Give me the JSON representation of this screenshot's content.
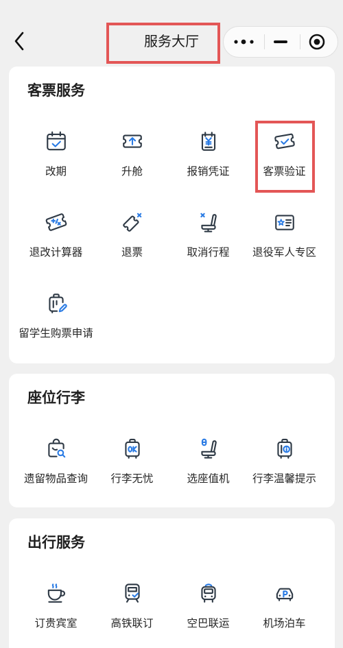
{
  "nav": {
    "back_icon": "chevron-left-icon",
    "title": "服务大厅",
    "title_highlighted": true,
    "capsule": {
      "more_icon": "more-dots-icon",
      "minimize_icon": "minus-icon",
      "close_icon": "target-circle-icon"
    }
  },
  "colors": {
    "page_bg": "#f0f0f0",
    "card_bg": "#ffffff",
    "text": "#222222",
    "icon_stroke": "#2f3a46",
    "icon_accent": "#2a7be4",
    "highlight_box": "#e35656"
  },
  "sections": [
    {
      "title": "客票服务",
      "items": [
        {
          "label": "改期",
          "icon": "calendar-check-icon"
        },
        {
          "label": "升舱",
          "icon": "ticket-upgrade-icon"
        },
        {
          "label": "报销凭证",
          "icon": "receipt-yen-icon"
        },
        {
          "label": "客票验证",
          "icon": "ticket-check-icon",
          "highlighted": true
        },
        {
          "label": "退改计算器",
          "icon": "refund-calculator-icon"
        },
        {
          "label": "退票",
          "icon": "ticket-refund-icon"
        },
        {
          "label": "取消行程",
          "icon": "seat-cancel-icon"
        },
        {
          "label": "退役军人专区",
          "icon": "veteran-card-icon"
        },
        {
          "label": "留学生购票申请",
          "icon": "luggage-pen-icon"
        }
      ]
    },
    {
      "title": "座位行李",
      "items": [
        {
          "label": "遗留物品查询",
          "icon": "bag-search-icon"
        },
        {
          "label": "行李无忧",
          "icon": "suitcase-ok-icon"
        },
        {
          "label": "选座值机",
          "icon": "seat-select-icon"
        },
        {
          "label": "行李温馨提示",
          "icon": "suitcase-info-icon"
        }
      ]
    },
    {
      "title": "出行服务",
      "items": [
        {
          "label": "订贵宾室",
          "icon": "coffee-cup-icon"
        },
        {
          "label": "高铁联订",
          "icon": "train-check-icon"
        },
        {
          "label": "空巴联运",
          "icon": "bus-icon"
        },
        {
          "label": "机场泊车",
          "icon": "car-parking-icon"
        }
      ]
    }
  ]
}
